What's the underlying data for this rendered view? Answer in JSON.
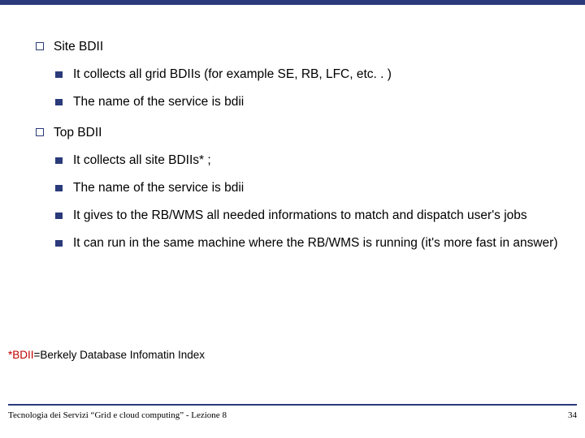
{
  "items": [
    {
      "label": "Site BDII",
      "children": [
        "It collects all grid BDIIs (for example SE, RB, LFC, etc. . )",
        "The name of the service is bdii"
      ]
    },
    {
      "label": "Top BDII",
      "children": [
        "It collects all site BDIIs* ;",
        "The name of the service is bdii",
        "It gives to the RB/WMS all needed informations to match and dispatch user's jobs",
        "It can run in the same machine where the RB/WMS is running (it's more fast in answer)"
      ]
    }
  ],
  "footnote_colored": "*BDII",
  "footnote_rest": "=Berkely Database Infomatin Index",
  "footer_left": "Tecnologia dei Servizi “Grid e cloud computing” - Lezione 8",
  "footer_right": "34"
}
